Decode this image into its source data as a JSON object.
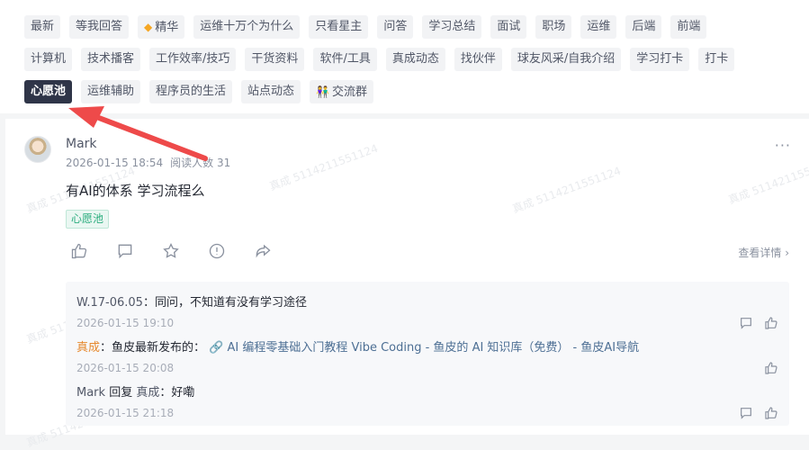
{
  "tags_row1": [
    "最新",
    "等我回答",
    "精华",
    "运维十万个为什么",
    "只看星主",
    "问答",
    "学习总结",
    "面试",
    "职场",
    "运维",
    "后端",
    "前端"
  ],
  "tags_row2": [
    "计算机",
    "技术播客",
    "工作效率/技巧",
    "干货资料",
    "软件/工具",
    "真成动态",
    "找伙伴",
    "球友风采/自我介绍",
    "学习打卡",
    "打卡"
  ],
  "tags_row3": [
    "心愿池",
    "运维辅助",
    "程序员的生活",
    "站点动态",
    "交流群"
  ],
  "post": {
    "author": "Mark",
    "date": "2026-01-15 18:54",
    "reads": "阅读人数 31",
    "title": "有AI的体系 学习流程么",
    "tag": "心愿池",
    "detail_link": "查看详情",
    "more": "···"
  },
  "comments": [
    {
      "user": "W.17-06.05",
      "text": "：同问，不知道有没有学习途径",
      "time": "2026-01-15 19:10"
    },
    {
      "user": "真成",
      "text": "：鱼皮最新发布的：",
      "link": "AI 编程零基础入门教程 Vibe Coding - 鱼皮的 AI 知识库（免费） - 鱼皮AI导航",
      "time": "2026-01-15 20:08"
    },
    {
      "user": "Mark",
      "reply_word": " 回复 ",
      "reply_to": "真成",
      "text": "：好嘞",
      "time": "2026-01-15 21:18"
    }
  ],
  "watermark_text": "真成 5114211551124",
  "colors": {
    "active_tag": "#2f3548",
    "accent_orange": "#e6892e",
    "link": "#4d6f94",
    "post_tag": "#2bad7e",
    "arrow": "#ee4a4a"
  },
  "icons": {
    "tag_jinghua": "diamond-icon",
    "tag_jiaoliu": "people-icon",
    "actions": [
      "thumbs-up-icon",
      "comment-icon",
      "star-icon",
      "alert-icon",
      "share-icon"
    ],
    "detail": "chevron-right-icon",
    "comment_ops": [
      "comment-icon",
      "thumbs-up-icon"
    ],
    "link": "link-icon"
  }
}
